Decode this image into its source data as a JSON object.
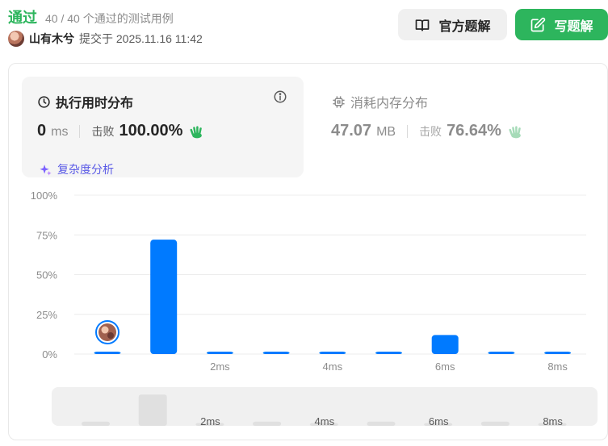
{
  "header": {
    "status": "通过",
    "cases": "40 / 40 个通过的测试用例",
    "author": "山有木兮",
    "submitted": "提交于 2025.11.16 11:42"
  },
  "buttons": {
    "official_label": "官方题解",
    "write_label": "写题解"
  },
  "runtime": {
    "title": "执行用时分布",
    "value": "0",
    "unit": "ms",
    "beat_label": "击败",
    "beat_value": "100.00%",
    "complexity_label": "复杂度分析"
  },
  "memory": {
    "title": "消耗内存分布",
    "value": "47.07",
    "unit": "MB",
    "beat_label": "击败",
    "beat_value": "76.64%"
  },
  "colors": {
    "accent_green": "#2db55d",
    "bar_blue": "#007aff",
    "complexity_purple": "#5a5ae6"
  },
  "chart_data": {
    "type": "bar",
    "x": [
      0,
      1,
      2,
      3,
      4,
      5,
      6,
      7,
      8
    ],
    "values": [
      1.5,
      72,
      1.5,
      1.5,
      1.5,
      1.5,
      12,
      1.5,
      1.5
    ],
    "overview_values": [
      3,
      22,
      2,
      3,
      2,
      3,
      2,
      3,
      2
    ],
    "x_tick_labels": [
      "2ms",
      "4ms",
      "6ms",
      "8ms"
    ],
    "x_tick_positions": [
      2,
      4,
      6,
      8
    ],
    "y_tick_labels": [
      "100%",
      "75%",
      "50%",
      "25%",
      "0%"
    ],
    "ylim": [
      0,
      100
    ],
    "highlight_index": 0,
    "grid": true
  }
}
